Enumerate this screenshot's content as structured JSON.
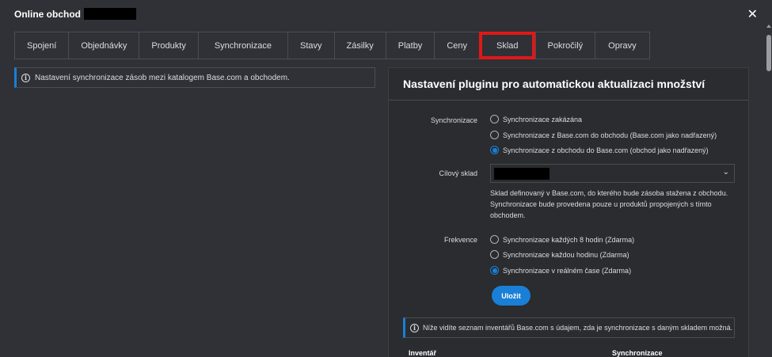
{
  "window": {
    "title": "Online obchod"
  },
  "tabs": [
    {
      "label": "Spojení"
    },
    {
      "label": "Objednávky"
    },
    {
      "label": "Produkty"
    },
    {
      "label": "Synchronizace"
    },
    {
      "label": "Stavy"
    },
    {
      "label": "Zásilky"
    },
    {
      "label": "Platby"
    },
    {
      "label": "Ceny"
    },
    {
      "label": "Sklad"
    },
    {
      "label": "Pokročilý"
    },
    {
      "label": "Opravy"
    }
  ],
  "active_tab": "Sklad",
  "left_info": {
    "text": "Nastavení synchronizace zásob mezi katalogem Base.com a obchodem."
  },
  "panel": {
    "title": "Nastavení pluginu pro automatickou aktualizaci množství",
    "sync_label": "Synchronizace",
    "sync_options": [
      {
        "label": "Synchronizace zakázána",
        "checked": false
      },
      {
        "label": "Synchronizace z Base.com do obchodu (Base.com jako nadřazený)",
        "checked": false
      },
      {
        "label": "Synchronizace z obchodu do Base.com (obchod jako nadřazený)",
        "checked": true
      }
    ],
    "warehouse_label": "Cílový sklad",
    "warehouse_help": "Sklad definovaný v Base.com, do kterého bude zásoba stažena z obchodu. Synchronizace bude provedena pouze u produktů propojených s tímto obchodem.",
    "freq_label": "Frekvence",
    "freq_options": [
      {
        "label": "Synchronizace každých 8 hodin (Zdarma)",
        "checked": false
      },
      {
        "label": "Synchronizace každou hodinu (Zdarma)",
        "checked": false
      },
      {
        "label": "Synchronizace v reálném čase (Zdarma)",
        "checked": true
      }
    ],
    "save_label": "Uložit",
    "info_text": "Níže vidíte seznam inventářů Base.com s údajem, zda je synchronizace s daným skladem možná.",
    "col_inventory": "Inventář",
    "col_sync": "Synchronizace"
  },
  "colors": {
    "accent": "#1a7fd6",
    "highlight": "#e01818",
    "background": "#2f3136"
  }
}
